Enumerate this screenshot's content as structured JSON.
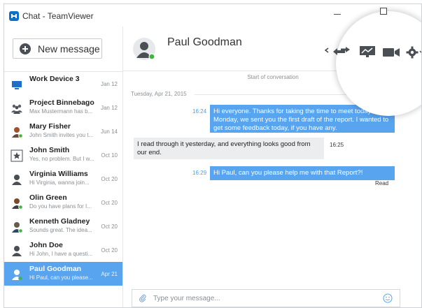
{
  "window": {
    "title": "Chat - TeamViewer"
  },
  "sidebar": {
    "new_message_label": "New message",
    "contacts": [
      {
        "name": "Work Device 3",
        "preview": "",
        "date": "Jan 12",
        "icon": "computer-icon"
      },
      {
        "name": "Project Binnebago",
        "preview": "Max Mustermann has b...",
        "date": "Jan 12",
        "icon": "group-icon"
      },
      {
        "name": "Mary Fisher",
        "preview": "John Smith invites you t...",
        "date": "Jun 14",
        "icon": "user-avatar-online"
      },
      {
        "name": "John Smith",
        "preview": "Yes, no problem. But I w...",
        "date": "Oct 10",
        "icon": "star-icon"
      },
      {
        "name": "Virginia Williams",
        "preview": "Hi Virginia, wanna join...",
        "date": "Oct 20",
        "icon": "user-avatar"
      },
      {
        "name": "Olin Green",
        "preview": "Do you have plans for I...",
        "date": "Oct 20",
        "icon": "user-avatar-online"
      },
      {
        "name": "Kenneth Gladney",
        "preview": "Sounds great. The idea...",
        "date": "Oct 20",
        "icon": "user-avatar-online"
      },
      {
        "name": "John Doe",
        "preview": "Hi John, I have a questi...",
        "date": "Oct 20",
        "icon": "user-avatar"
      },
      {
        "name": "Paul Goodman",
        "preview": "Hi Paul, can you please...",
        "date": "Apr 21",
        "icon": "user-avatar-online",
        "selected": true
      }
    ]
  },
  "conversation": {
    "contact_name": "Paul Goodman",
    "start_label": "Start of conversation",
    "date_label": "Tuesday, Apr 21, 2015",
    "messages": [
      {
        "direction": "out",
        "time": "16:24",
        "text": "Hi everyone. Thanks for taking the time to meet today. Monday, we sent you the first draft of the report. I wanted to get some feedback today, if you have any."
      },
      {
        "direction": "in",
        "time": "16:25",
        "text": "I read through it yesterday, and everything looks good from our end."
      },
      {
        "direction": "out",
        "time": "16:29",
        "text": "Hi Paul, can you please help me with that Report?!"
      }
    ],
    "read_label": "Read",
    "input_placeholder": "Type your message..."
  },
  "toolbar": {
    "icons": [
      "remote-control-icon",
      "presentation-icon",
      "video-call-icon",
      "settings-icon"
    ]
  },
  "colors": {
    "accent": "#59a4ef",
    "online": "#3cb93c",
    "avatar": "#4a4f55"
  }
}
